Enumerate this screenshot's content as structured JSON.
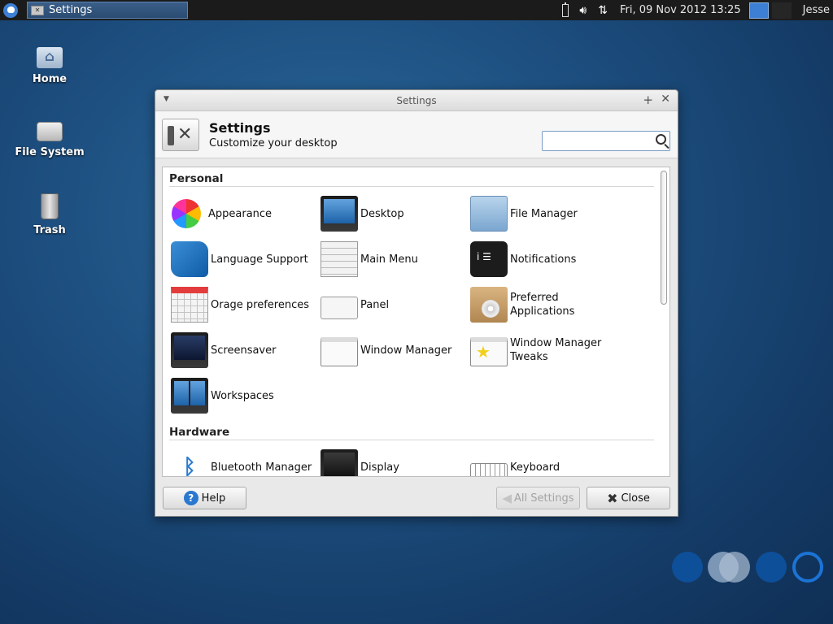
{
  "panel": {
    "task_title": "Settings",
    "clock": "Fri, 09 Nov 2012 13:25",
    "user": "Jesse",
    "tray_icons": [
      "battery-icon",
      "volume-icon",
      "network-icon"
    ]
  },
  "desktop": {
    "icons": [
      {
        "label": "Home",
        "icon": "home-folder-icon"
      },
      {
        "label": "File System",
        "icon": "drive-icon"
      },
      {
        "label": "Trash",
        "icon": "trash-icon"
      }
    ]
  },
  "window": {
    "title": "Settings",
    "header_title": "Settings",
    "header_subtitle": "Customize your desktop",
    "search_placeholder": "",
    "sections": [
      {
        "title": "Personal",
        "items": [
          {
            "label": "Appearance",
            "icon": "appearance-icon"
          },
          {
            "label": "Desktop",
            "icon": "desktop-icon"
          },
          {
            "label": "File Manager",
            "icon": "file-manager-icon"
          },
          {
            "label": "Language Support",
            "icon": "language-support-icon"
          },
          {
            "label": "Main Menu",
            "icon": "main-menu-icon"
          },
          {
            "label": "Notifications",
            "icon": "notifications-icon"
          },
          {
            "label": "Orage preferences",
            "icon": "calendar-icon"
          },
          {
            "label": "Panel",
            "icon": "panel-icon"
          },
          {
            "label": "Preferred Applications",
            "icon": "preferred-applications-icon"
          },
          {
            "label": "Screensaver",
            "icon": "screensaver-icon"
          },
          {
            "label": "Window Manager",
            "icon": "window-manager-icon"
          },
          {
            "label": "Window Manager Tweaks",
            "icon": "window-manager-tweaks-icon"
          },
          {
            "label": "Workspaces",
            "icon": "workspaces-icon"
          }
        ]
      },
      {
        "title": "Hardware",
        "items": [
          {
            "label": "Bluetooth Manager",
            "icon": "bluetooth-icon"
          },
          {
            "label": "Display",
            "icon": "display-icon"
          },
          {
            "label": "Keyboard",
            "icon": "keyboard-icon"
          }
        ]
      }
    ],
    "buttons": {
      "help": "Help",
      "all_settings": "All Settings",
      "close": "Close"
    }
  },
  "colors": {
    "accent": "#3d7fd4",
    "panel_bg": "#1b1b1b",
    "desktop_bg": "#1d4f80"
  }
}
